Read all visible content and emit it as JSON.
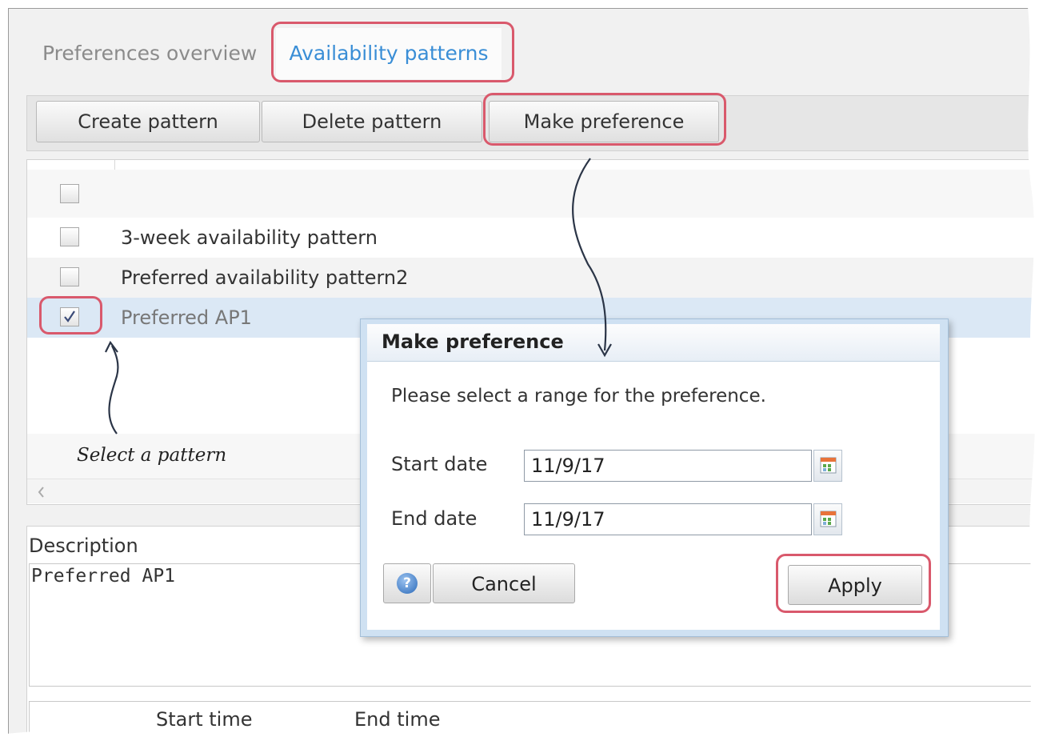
{
  "tabs": [
    {
      "label": "Preferences overview",
      "active": false
    },
    {
      "label": "Availability patterns",
      "active": true
    }
  ],
  "toolbar": {
    "create_label": "Create pattern",
    "delete_label": "Delete pattern",
    "make_preference_label": "Make preference"
  },
  "patterns": [
    {
      "label": "3-week availability pattern",
      "checked": false
    },
    {
      "label": "Preferred availability pattern2",
      "checked": false
    },
    {
      "label": "Preferred AP1",
      "checked": true
    }
  ],
  "description": {
    "label": "Description",
    "value": "Preferred AP1"
  },
  "times": {
    "start_label": "Start time",
    "end_label": "End time"
  },
  "dialog": {
    "title": "Make preference",
    "message": "Please select a range for the preference.",
    "start_label": "Start date",
    "start_value": "11/9/17",
    "end_label": "End date",
    "end_value": "11/9/17",
    "cancel_label": "Cancel",
    "apply_label": "Apply",
    "help_icon": "?"
  },
  "annotation": "Select a pattern",
  "colors": {
    "highlight": "#d9596c",
    "active_tab_text": "#3a8ed6",
    "selected_row": "#dbe8f5"
  }
}
